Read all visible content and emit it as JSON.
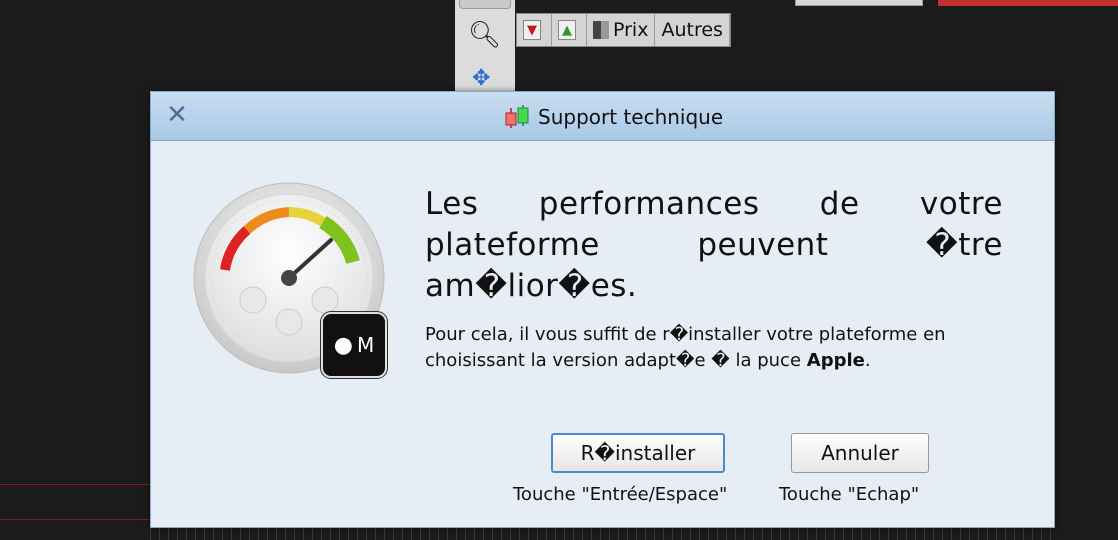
{
  "background": {
    "tabs": [
      {
        "label": ""
      },
      {
        "label": ""
      },
      {
        "label": "Prix"
      },
      {
        "label": "Autres"
      }
    ]
  },
  "dialog": {
    "title": "Support technique",
    "headline": "Les performances de votre plateforme peuvent �tre am�lior�es.",
    "body_prefix": "Pour cela, il vous suffit de r�installer votre plateforme en choisissant la version adapt�e � la puce ",
    "body_bold": "Apple",
    "body_suffix": ".",
    "chip_label": "M",
    "buttons": {
      "reinstall": "R�installer",
      "cancel": "Annuler"
    },
    "hints": {
      "reinstall": "Touche \"Entrée/Espace\"",
      "cancel": "Touche \"Echap\""
    }
  },
  "colors": {
    "titlebar": "#b8d3ec",
    "dialog_bg": "#e6edf4",
    "primary_border": "#4a8ad0"
  },
  "icons": {
    "close": "close-icon",
    "title": "candlestick-icon",
    "gauge": "speedometer-icon",
    "chip": "apple-chip-icon"
  }
}
